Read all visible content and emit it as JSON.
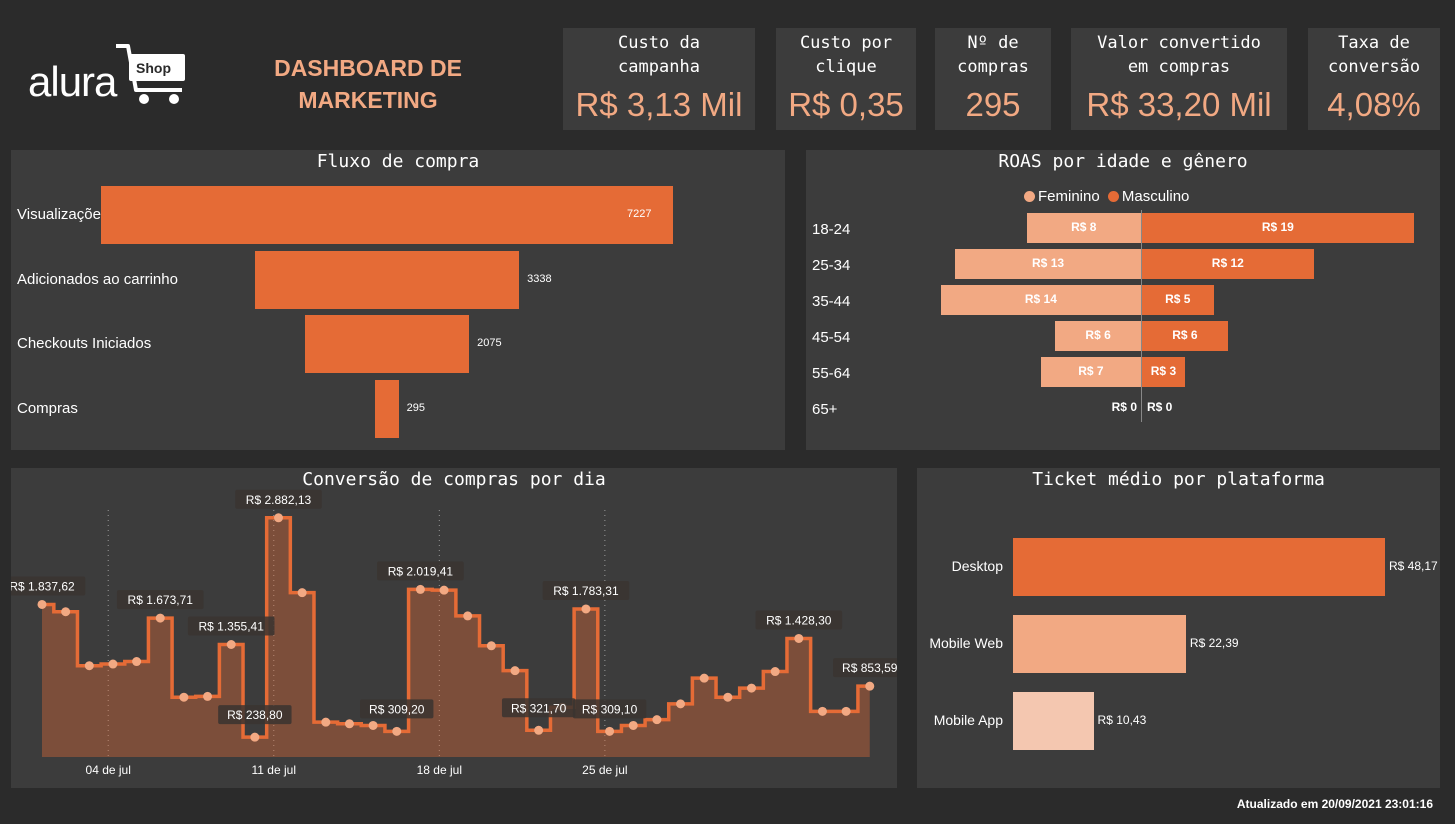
{
  "header": {
    "logo_text": "alura",
    "logo_badge": "Shop",
    "title_line1": "DASHBOARD DE",
    "title_line2": "MARKETING"
  },
  "kpis": [
    {
      "label_1": "Custo da",
      "label_2": "campanha",
      "value": "R$ 3,13 Mil"
    },
    {
      "label_1": "Custo por",
      "label_2": "clique",
      "value": "R$ 0,35"
    },
    {
      "label_1": "Nº de",
      "label_2": "compras",
      "value": "295"
    },
    {
      "label_1": "Valor convertido",
      "label_2": "em compras",
      "value": "R$ 33,20 Mil"
    },
    {
      "label_1": "Taxa de",
      "label_2": "conversão",
      "value": "4,08%"
    }
  ],
  "colors": {
    "accent": "#e56b36",
    "light": "#f2a983",
    "lighter": "#f4c7b0",
    "panel": "#3c3c3c",
    "background": "#2b2b2b"
  },
  "footer": {
    "updated": "Atualizado em 20/09/2021 23:01:16"
  },
  "chart_data": [
    {
      "type": "bar",
      "title": "Fluxo de compra",
      "categories": [
        "Visualizações por página",
        "Adicionados ao carrinho",
        "Checkouts Iniciados",
        "Compras"
      ],
      "values": [
        7227,
        3338,
        2075,
        295
      ],
      "value_labels": [
        "7227",
        "3338",
        "2075",
        "295"
      ]
    },
    {
      "type": "bar",
      "title": "ROAS por idade e gênero",
      "categories": [
        "18-24",
        "25-34",
        "35-44",
        "45-54",
        "55-64",
        "65+"
      ],
      "series": [
        {
          "name": "Feminino",
          "values": [
            8,
            13,
            14,
            6,
            7,
            0
          ],
          "labels": [
            "R$ 8",
            "R$ 13",
            "R$ 14",
            "R$ 6",
            "R$ 7",
            "R$ 0"
          ]
        },
        {
          "name": "Masculino",
          "values": [
            19,
            12,
            5,
            6,
            3,
            0
          ],
          "labels": [
            "R$ 19",
            "R$ 12",
            "R$ 5",
            "R$ 6",
            "R$ 3",
            "R$ 0"
          ]
        }
      ],
      "legend": "top"
    },
    {
      "type": "area",
      "title": "Conversão de compras por dia",
      "x_ticks": [
        "04 de jul",
        "11 de jul",
        "18 de jul",
        "25 de jul"
      ],
      "values": [
        1837.62,
        1750,
        1100,
        1120,
        1150,
        1673.71,
        720,
        730,
        1355.41,
        238.8,
        2882.13,
        1980,
        420,
        400,
        380,
        309.2,
        2019.41,
        2010,
        1700,
        1340,
        1040,
        321.7,
        600,
        1783.31,
        309.1,
        380,
        450,
        640,
        950,
        720,
        830,
        1030,
        1428.3,
        550,
        550,
        853.59
      ],
      "annotations": [
        {
          "index": 0,
          "label": "R$ 1.837,62"
        },
        {
          "index": 5,
          "label": "R$ 1.673,71"
        },
        {
          "index": 8,
          "label": "R$ 1.355,41"
        },
        {
          "index": 9,
          "label": "R$ 238,80"
        },
        {
          "index": 10,
          "label": "R$ 2.882,13"
        },
        {
          "index": 15,
          "label": "R$ 309,20"
        },
        {
          "index": 16,
          "label": "R$ 2.019,41"
        },
        {
          "index": 21,
          "label": "R$ 321,70"
        },
        {
          "index": 23,
          "label": "R$ 1.783,31"
        },
        {
          "index": 24,
          "label": "R$ 309,10"
        },
        {
          "index": 32,
          "label": "R$ 1.428,30"
        },
        {
          "index": 35,
          "label": "R$ 853,59"
        }
      ],
      "ylim": [
        0,
        3000
      ]
    },
    {
      "type": "bar",
      "title": "Ticket médio por plataforma",
      "categories": [
        "Desktop",
        "Mobile Web",
        "Mobile App"
      ],
      "values": [
        48.17,
        22.39,
        10.43
      ],
      "value_labels": [
        "R$ 48,17",
        "R$ 22,39",
        "R$ 10,43"
      ]
    }
  ]
}
